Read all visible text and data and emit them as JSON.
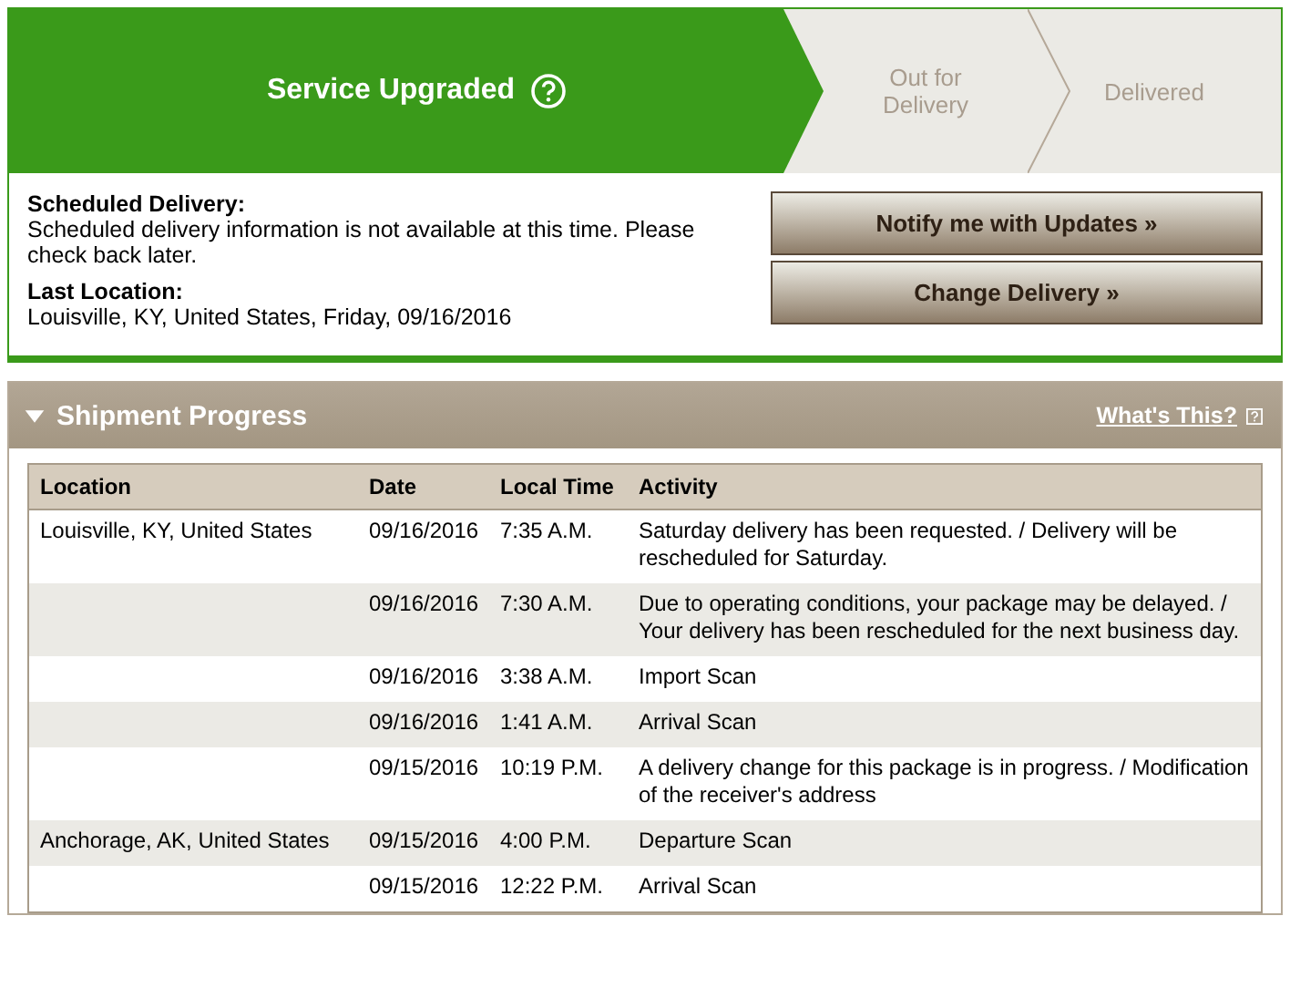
{
  "steps": [
    {
      "label": "Service Upgraded",
      "selected": true,
      "help_icon": true
    },
    {
      "label": "Out for Delivery",
      "selected": false,
      "help_icon": false
    },
    {
      "label": "Delivered",
      "selected": false,
      "help_icon": false
    }
  ],
  "delivery": {
    "scheduled_label": "Scheduled Delivery:",
    "scheduled_text": "Scheduled delivery information is not available at this time. Please check back later.",
    "last_location_label": "Last Location:",
    "last_location_text": "Louisville, KY, United States, Friday, 09/16/2016"
  },
  "buttons": [
    "Notify me with Updates »",
    "Change Delivery »"
  ],
  "progress": {
    "title": "Shipment Progress",
    "expanded": true,
    "help_link": "What's This?",
    "table": {
      "columns": [
        "Location",
        "Date",
        "Local Time",
        "Activity"
      ],
      "rows": [
        {
          "location": "Louisville, KY, United States",
          "date": "09/16/2016",
          "time": "7:35 A.M.",
          "activity": "Saturday delivery has been requested. / Delivery will be rescheduled for Saturday."
        },
        {
          "date": "09/16/2016",
          "time": "7:30 A.M.",
          "activity": "Due to operating conditions, your package may be delayed. / Your delivery has been rescheduled for the next business day."
        },
        {
          "date": "09/16/2016",
          "time": "3:38 A.M.",
          "activity": "Import Scan"
        },
        {
          "date": "09/16/2016",
          "time": "1:41 A.M.",
          "activity": "Arrival Scan"
        },
        {
          "date": "09/15/2016",
          "time": "10:19 P.M.",
          "activity": "A delivery change for this package is in progress. / Modification of the receiver's address"
        },
        {
          "location": "Anchorage, AK, United States",
          "date": "09/15/2016",
          "time": "4:00 P.M.",
          "activity": "Departure Scan"
        },
        {
          "date": "09/15/2016",
          "time": "12:22 P.M.",
          "activity": "Arrival Scan"
        }
      ]
    }
  }
}
